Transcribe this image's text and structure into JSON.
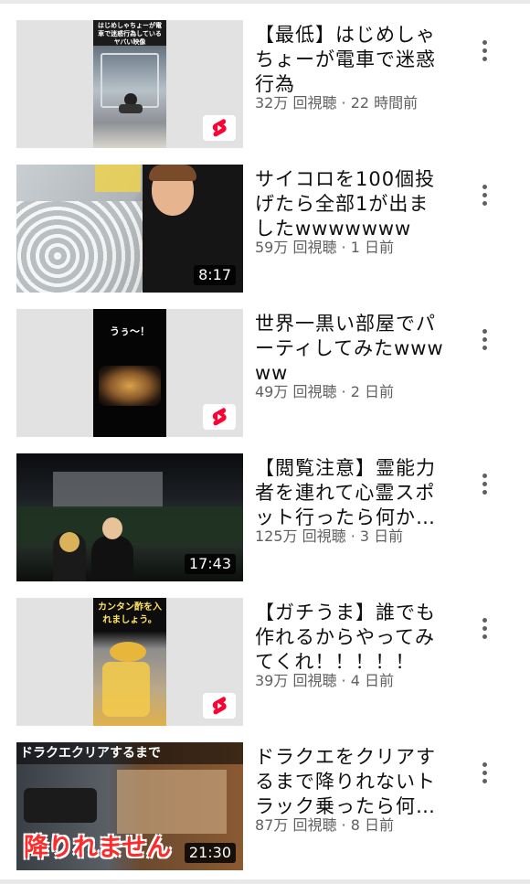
{
  "videos": [
    {
      "title": "【最低】はじめしゃちょーが電車で迷惑行為",
      "views": "32万 回視聴",
      "age": "22 時間前",
      "type": "shorts",
      "thumb_caption": "はじめしゃちょーが電車で迷惑行為しているヤバい映像"
    },
    {
      "title": "サイコロを100個投げたら全部1が出ましたwwwwwww",
      "views": "59万 回視聴",
      "age": "1 日前",
      "type": "video",
      "duration": "8:17"
    },
    {
      "title": "世界一黒い部屋でパーティしてみたwwwww",
      "views": "49万 回視聴",
      "age": "2 日前",
      "type": "shorts",
      "thumb_caption": "うぅ～！"
    },
    {
      "title": "【閲覧注意】霊能力者を連れて心霊スポット行ったら何か…",
      "views": "125万 回視聴",
      "age": "3 日前",
      "type": "video",
      "duration": "17:43"
    },
    {
      "title": "【ガチうま】誰でも作れるからやってみてくれ！！！！！",
      "views": "39万 回視聴",
      "age": "4 日前",
      "type": "shorts",
      "thumb_caption": "カンタン酢を入れましょう。"
    },
    {
      "title": "ドラクエをクリアするまで降りれないトラック乗ったら何…",
      "views": "87万 回視聴",
      "age": "8 日前",
      "type": "video",
      "duration": "21:30",
      "thumb_caption_top": "ドラクエクリアするまで",
      "thumb_caption_bottom": "降りれません"
    }
  ],
  "meta_separator": " · ",
  "colors": {
    "shorts_red": "#ff0033",
    "meta_gray": "#606060",
    "title_black": "#0f0f0f"
  },
  "icons": {
    "more": "more-vert-icon",
    "shorts": "shorts-icon"
  }
}
